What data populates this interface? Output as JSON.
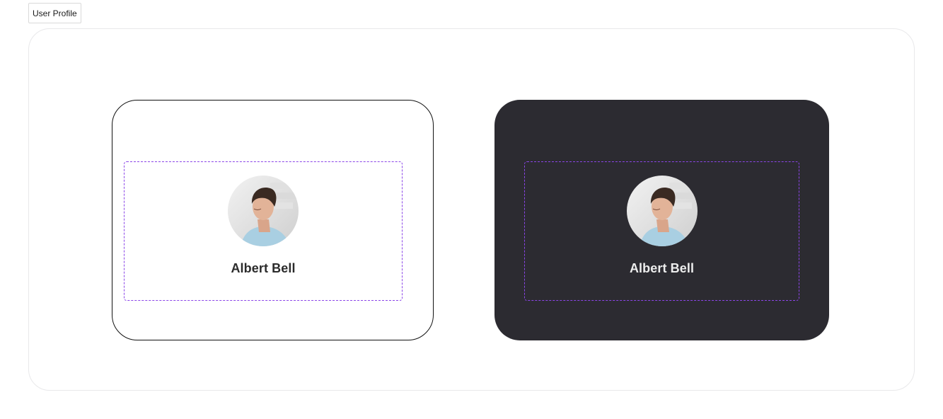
{
  "toolbar": {
    "tab_label": "User Profile"
  },
  "cards": [
    {
      "theme": "light",
      "profile": {
        "name": "Albert Bell",
        "avatar": "profile-photo"
      }
    },
    {
      "theme": "dark",
      "profile": {
        "name": "Albert Bell",
        "avatar": "profile-photo"
      }
    }
  ],
  "colors": {
    "dark_card_background": "#2c2b31",
    "dashed_outline": "#8b45e8",
    "light_card_border": "#111111"
  }
}
